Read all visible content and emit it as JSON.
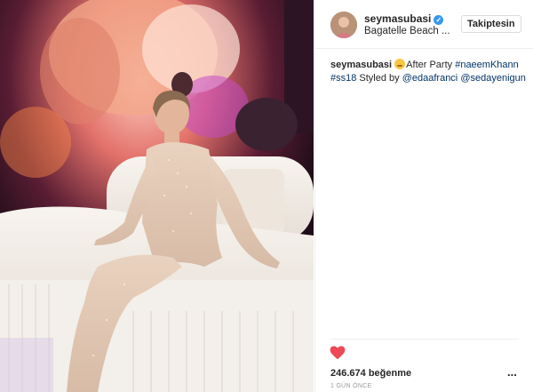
{
  "post": {
    "username": "seymasubasi",
    "location": "Bagatelle Beach ...",
    "follow_button": "Takiptesin",
    "caption": {
      "username": "seymasubasi",
      "text_after_emoji": "After Party ",
      "tag1": "#naeemKhann",
      "tag2": "#ss18",
      "styled_by": " Styled by ",
      "mention1": "@edaafranci",
      "mention2": "@sedayenigun"
    },
    "likes": "246.674 beğenme",
    "more": "...",
    "timestamp": "1 GÜN ÖNCE"
  },
  "icons": {
    "verified": "verified-badge-icon",
    "emoji": "face-emoji-icon",
    "heart": "heart-icon",
    "more": "more-options-icon"
  },
  "colors": {
    "heart": "#ed4956",
    "verified": "#3897f0",
    "link": "#003569",
    "timestamp": "#999999"
  }
}
